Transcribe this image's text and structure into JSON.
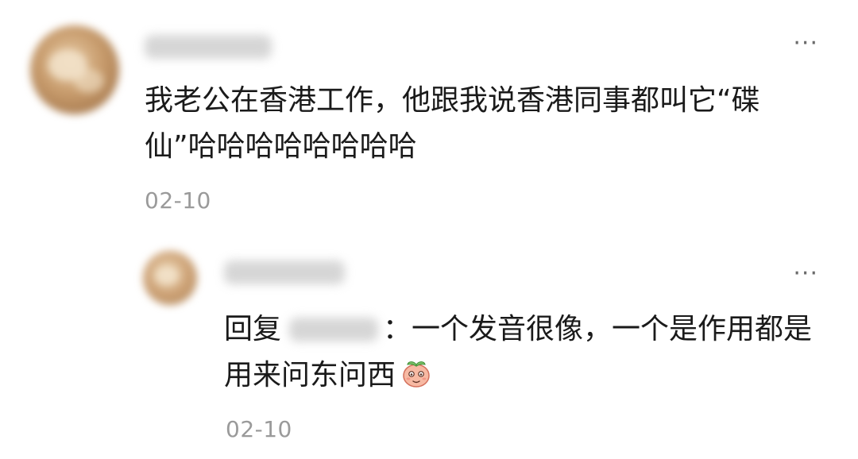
{
  "comment": {
    "more_label": "···",
    "text": "我老公在香港工作，他跟我说香港同事都叫它“碟仙”哈哈哈哈哈哈哈哈",
    "date": "02-10"
  },
  "reply": {
    "more_label": "···",
    "prefix": "回复",
    "text": "：一个发音很像，一个是作用都是用来问东问西",
    "emoji": "peach-face-emoji",
    "date": "02-10"
  },
  "colors": {
    "text": "#1a1a1a",
    "date": "#9a9a9a",
    "more": "#6b6b6b"
  }
}
